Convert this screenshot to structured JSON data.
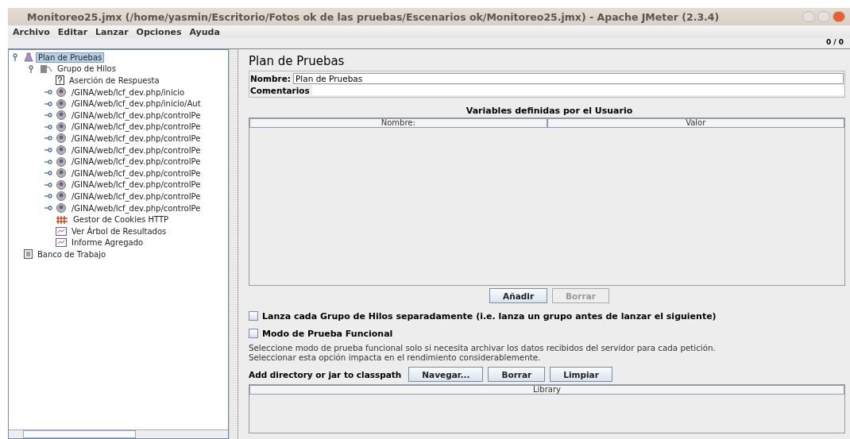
{
  "window": {
    "title": "Monitoreo25.jmx (/home/yasmin/Escritorio/Fotos ok de las pruebas/Escenarios ok/Monitoreo25.jmx) - Apache JMeter (2.3.4)"
  },
  "menu": [
    {
      "label": "Archivo"
    },
    {
      "label": "Editar"
    },
    {
      "label": "Lanzar"
    },
    {
      "label": "Opciones"
    },
    {
      "label": "Ayuda"
    }
  ],
  "status": "0 / 0",
  "tree": [
    {
      "label": "Plan de Pruebas",
      "kind": "plan",
      "selected": true,
      "expanded": true,
      "children": [
        {
          "label": "Grupo de Hilos",
          "kind": "threads",
          "selected": false,
          "expanded": true,
          "children": [
            {
              "label": "Aserción de Respuesta",
              "kind": "assertion",
              "selected": false
            },
            {
              "label": "/GINA/web/lcf_dev.php/inicio",
              "kind": "sampler",
              "selected": false,
              "expanded": false
            },
            {
              "label": "/GINA/web/lcf_dev.php/inicio/Aut",
              "kind": "sampler",
              "selected": false,
              "expanded": false
            },
            {
              "label": "/GINA/web/lcf_dev.php/controlPe",
              "kind": "sampler",
              "selected": false,
              "expanded": false
            },
            {
              "label": "/GINA/web/lcf_dev.php/controlPe",
              "kind": "sampler",
              "selected": false,
              "expanded": false
            },
            {
              "label": "/GINA/web/lcf_dev.php/controlPe",
              "kind": "sampler",
              "selected": false,
              "expanded": false
            },
            {
              "label": "/GINA/web/lcf_dev.php/controlPe",
              "kind": "sampler",
              "selected": false,
              "expanded": false
            },
            {
              "label": "/GINA/web/lcf_dev.php/controlPe",
              "kind": "sampler",
              "selected": false,
              "expanded": false
            },
            {
              "label": "/GINA/web/lcf_dev.php/controlPe",
              "kind": "sampler",
              "selected": false,
              "expanded": false
            },
            {
              "label": "/GINA/web/lcf_dev.php/controlPe",
              "kind": "sampler",
              "selected": false,
              "expanded": false
            },
            {
              "label": "/GINA/web/lcf_dev.php/controlPe",
              "kind": "sampler",
              "selected": false,
              "expanded": false
            },
            {
              "label": "/GINA/web/lcf_dev.php/controlPe",
              "kind": "sampler",
              "selected": false,
              "expanded": false
            },
            {
              "label": "Gestor de Cookies HTTP",
              "kind": "cookies",
              "selected": false
            },
            {
              "label": "Ver Árbol de Resultados",
              "kind": "listener",
              "selected": false
            },
            {
              "label": "Informe Agregado",
              "kind": "listener",
              "selected": false
            }
          ]
        }
      ]
    },
    {
      "label": "Banco de Trabajo",
      "kind": "workbench",
      "selected": false
    }
  ],
  "panel": {
    "title": "Plan de Pruebas",
    "name_label": "Nombre:",
    "name_value": "Plan de Pruebas",
    "comments_label": "Comentarios",
    "variables_title": "Variables definidas por el Usuario",
    "variables_columns": [
      "Nombre:",
      "Valor"
    ],
    "table_buttons": [
      {
        "label": "Añadir",
        "disabled": false
      },
      {
        "label": "Borrar",
        "disabled": true
      }
    ],
    "checkboxes": [
      {
        "label": "Lanza cada Grupo de Hilos separadamente (i.e. lanza un grupo antes de lanzar el siguiente)",
        "checked": false
      },
      {
        "label": "Modo de Prueba Funcional",
        "checked": false
      }
    ],
    "note": [
      "Seleccione modo de prueba funcional solo si necesita archivar los datos recibidos del servidor para cada petición.",
      "Seleccionar esta opción impacta en el rendimiento considerablemente."
    ],
    "classpath_label": "Add directory or jar to classpath",
    "classpath_buttons": [
      {
        "label": "Navegar...",
        "disabled": false
      },
      {
        "label": "Borrar",
        "disabled": false
      },
      {
        "label": "Limpiar",
        "disabled": false
      }
    ],
    "library_columns": [
      "Library"
    ]
  }
}
